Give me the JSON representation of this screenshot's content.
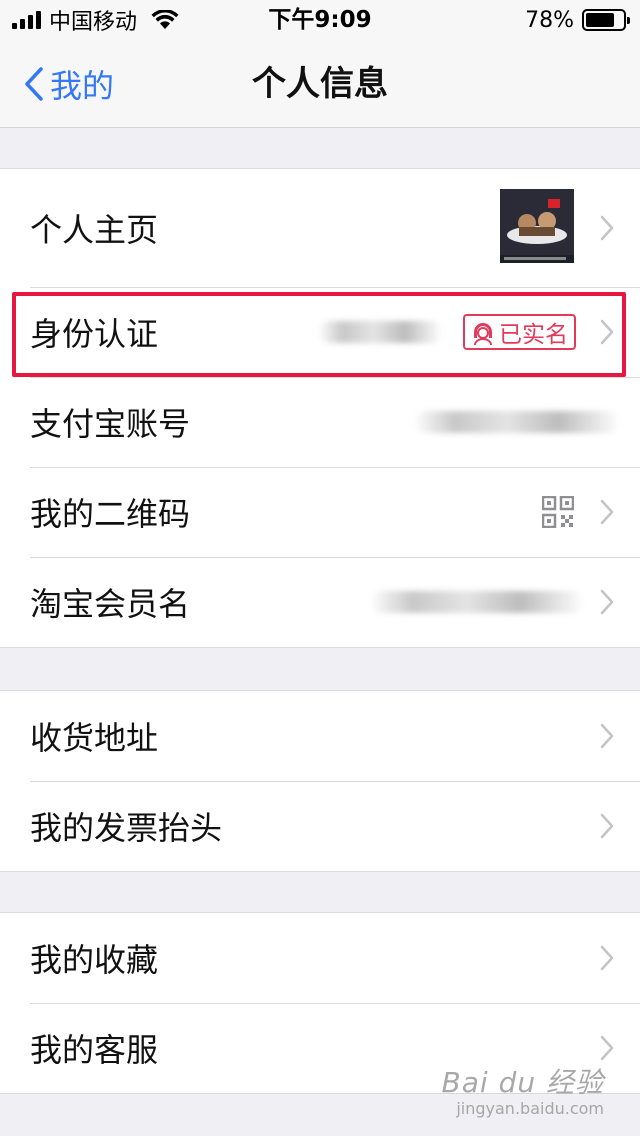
{
  "status_bar": {
    "carrier": "中国移动",
    "time": "下午9:09",
    "battery_percent": "78%",
    "battery_level": 0.78,
    "icons": [
      "signal-icon",
      "wifi-icon",
      "battery-icon"
    ]
  },
  "nav": {
    "back_label": "我的",
    "title": "个人信息"
  },
  "groups": [
    {
      "rows": [
        {
          "label": "个人主页",
          "accessory": "avatar"
        },
        {
          "label": "身份认证",
          "accessory": "blurred-value + verified-badge",
          "badge": "已实名",
          "highlighted": true
        },
        {
          "label": "支付宝账号",
          "accessory": "blurred-value"
        },
        {
          "label": "我的二维码",
          "accessory": "qr-code-icon"
        },
        {
          "label": "淘宝会员名",
          "accessory": "blurred-value"
        }
      ]
    },
    {
      "rows": [
        {
          "label": "收货地址"
        },
        {
          "label": "我的发票抬头"
        }
      ]
    },
    {
      "rows": [
        {
          "label": "我的收藏"
        },
        {
          "label": "我的客服"
        }
      ]
    }
  ],
  "watermark": {
    "main": "Bai du 经验",
    "sub": "jingyan.baidu.com"
  },
  "colors": {
    "accent": "#3478f6",
    "badge": "#e23a5a",
    "highlight": "#e8173f",
    "background": "#efeff4"
  }
}
